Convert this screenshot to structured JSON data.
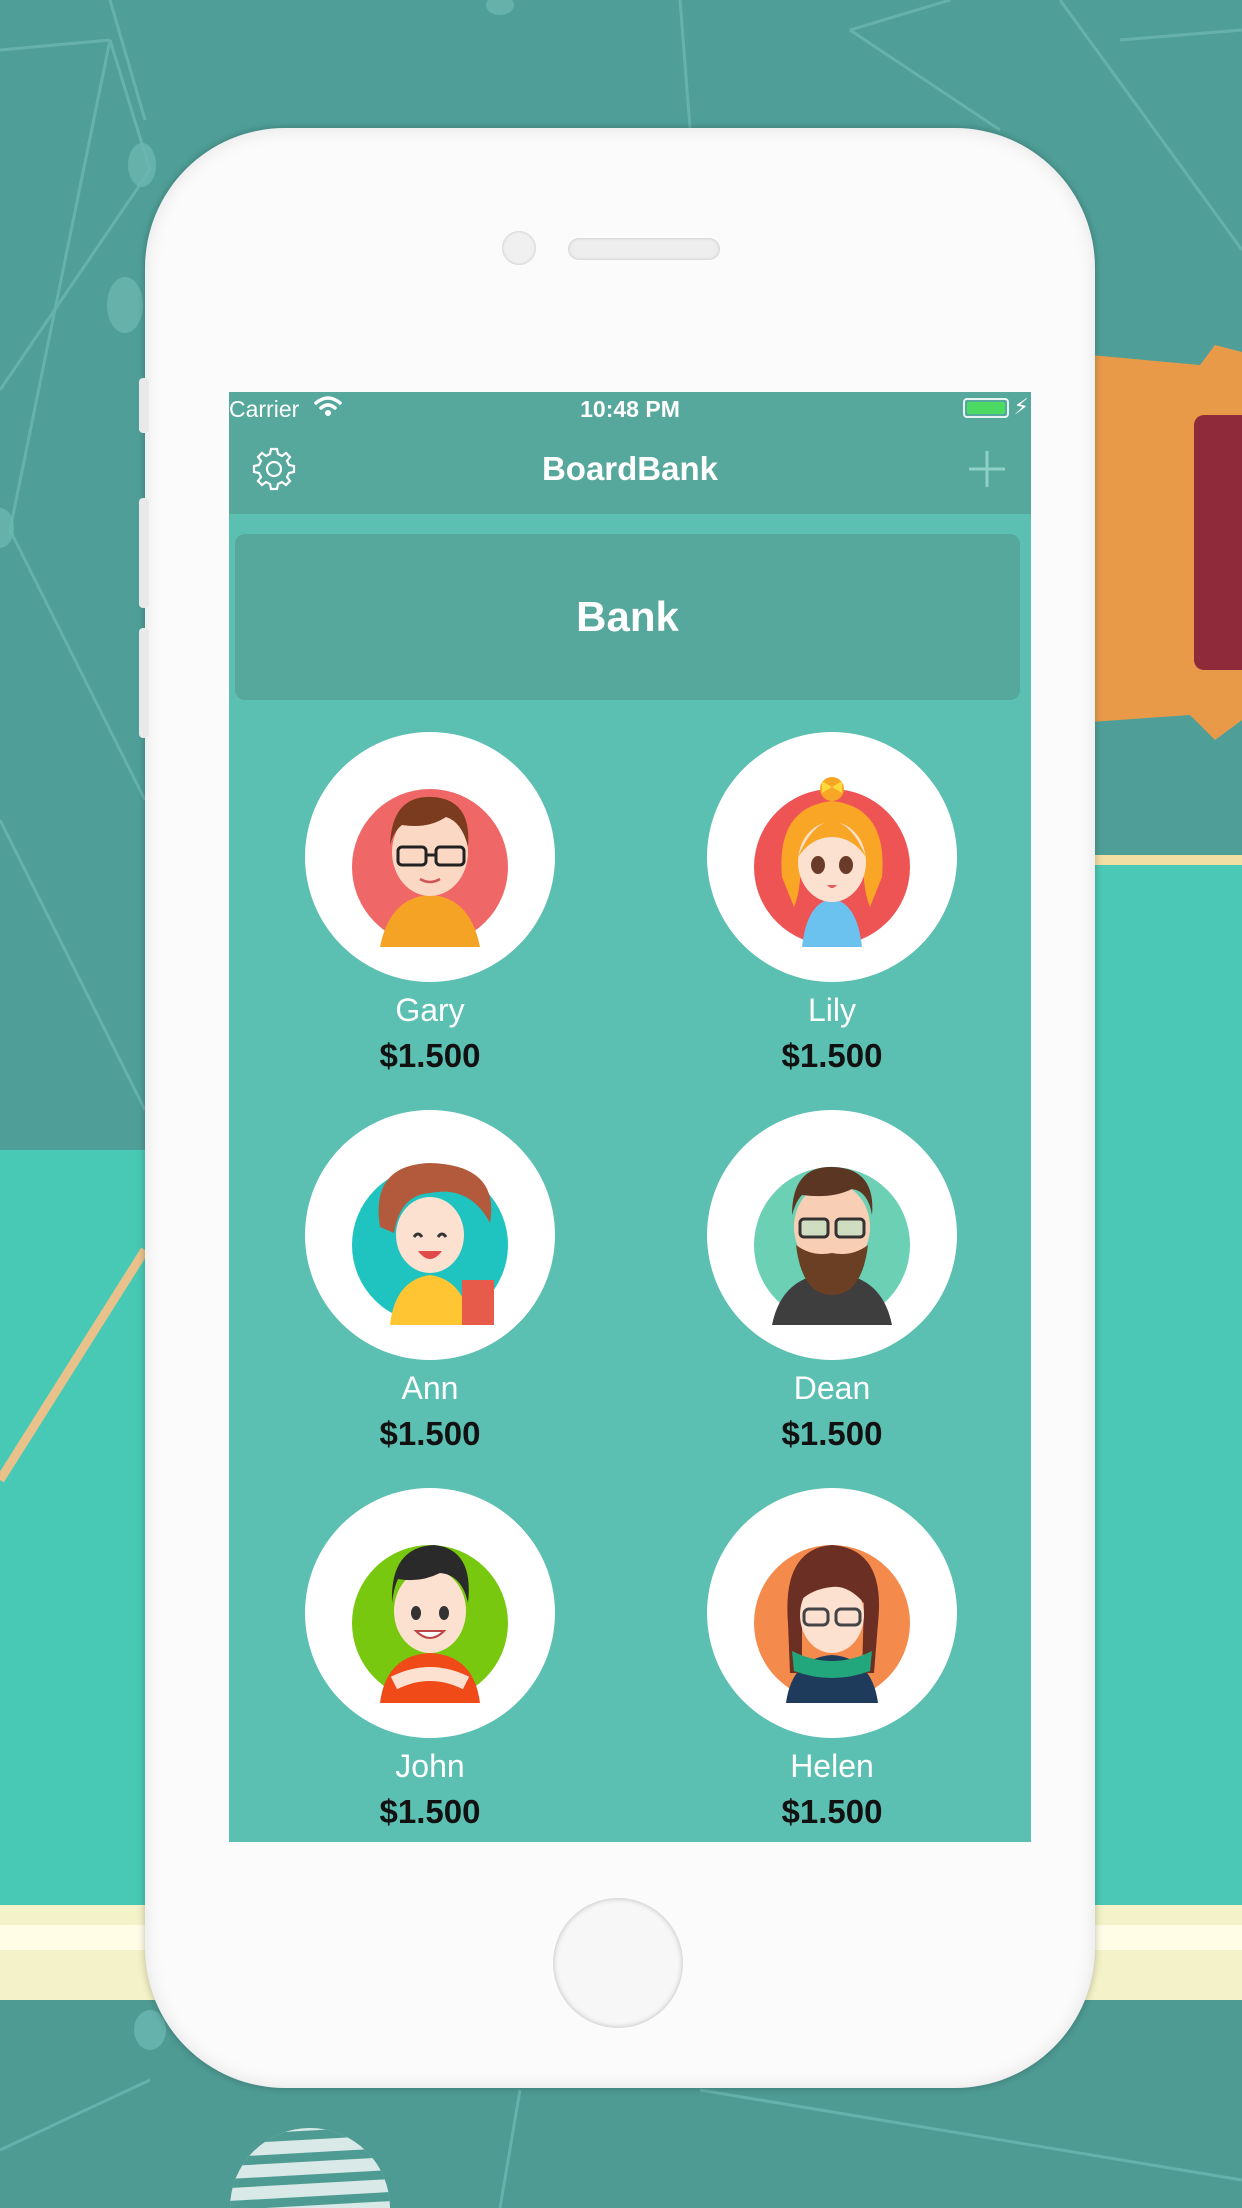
{
  "status_bar": {
    "carrier": "Carrier",
    "time": "10:48 PM"
  },
  "nav": {
    "title": "BoardBank",
    "left_icon": "gear-icon",
    "right_icon": "plus-icon"
  },
  "bank": {
    "label": "Bank"
  },
  "players": [
    {
      "name": "Gary",
      "money": "$1.500",
      "avatar_bg": "#f06767"
    },
    {
      "name": "Lily",
      "money": "$1.500",
      "avatar_bg": "#ee5454"
    },
    {
      "name": "Ann",
      "money": "$1.500",
      "avatar_bg": "#1fc3c0"
    },
    {
      "name": "Dean",
      "money": "$1.500",
      "avatar_bg": "#6cd0b4"
    },
    {
      "name": "John",
      "money": "$1.500",
      "avatar_bg": "#78c80f"
    },
    {
      "name": "Helen",
      "money": "$1.500",
      "avatar_bg": "#f48a4c"
    }
  ],
  "colors": {
    "screen_bg": "#5bbfb1",
    "bar_bg": "#56a79c",
    "bank_bg": "#56a79c",
    "battery": "#4cd964"
  }
}
